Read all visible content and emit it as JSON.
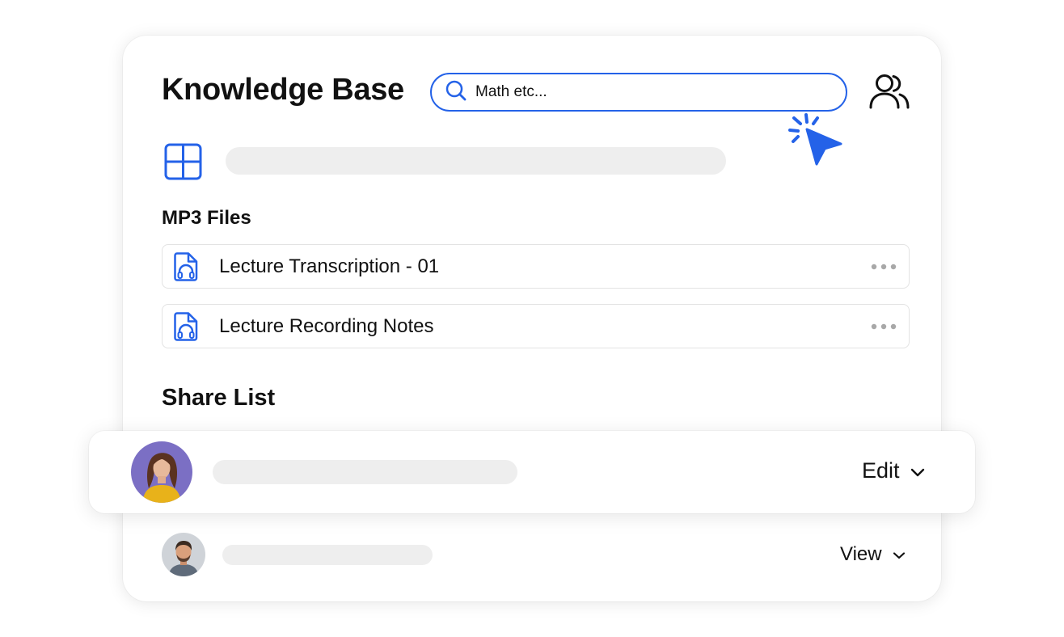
{
  "header": {
    "title": "Knowledge Base",
    "search_value": "Math etc...",
    "search_icon": "search-icon",
    "users_icon": "users-icon",
    "cursor_icon": "cursor-click-icon"
  },
  "toolbar": {
    "grid_icon": "grid-icon"
  },
  "mp3_section": {
    "label": "MP3 Files",
    "files": [
      {
        "name": "Lecture Transcription - 01",
        "icon": "audio-file-icon",
        "menu_icon": "more-icon"
      },
      {
        "name": "Lecture Recording Notes",
        "icon": "audio-file-icon",
        "menu_icon": "more-icon"
      }
    ]
  },
  "share_section": {
    "label": "Share List",
    "entries": [
      {
        "permission": "Edit",
        "avatar": "avatar-woman",
        "dropdown_icon": "chevron-down-icon"
      },
      {
        "permission": "View",
        "avatar": "avatar-man",
        "dropdown_icon": "chevron-down-icon"
      }
    ]
  },
  "colors": {
    "accent": "#2462e8",
    "text": "#111111",
    "skeleton": "#eeeeee",
    "border": "#e3e3e3",
    "avatar1_bg": "#7b6fc4",
    "avatar2_bg": "#cfd3d8"
  }
}
